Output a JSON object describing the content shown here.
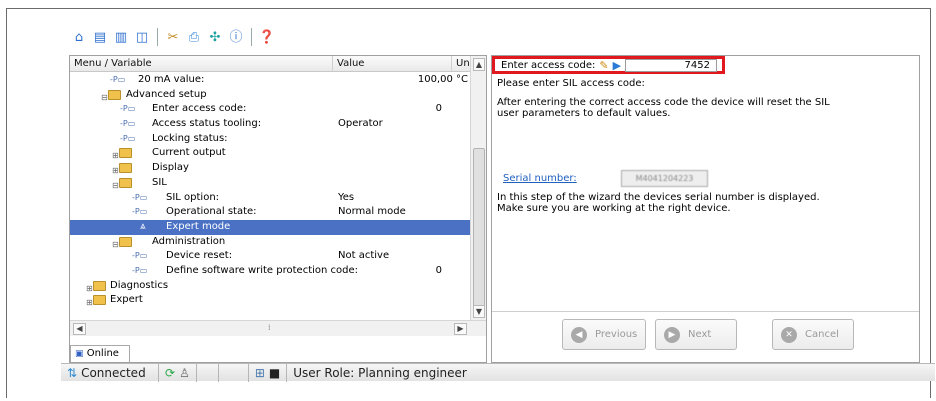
{
  "toolbar": {
    "icons": [
      "home-icon",
      "layout-split-icon",
      "layout-full-icon",
      "window-icon",
      "tools-icon",
      "print-icon",
      "network-icon",
      "info-icon",
      "help-icon"
    ]
  },
  "grid": {
    "col_menu": "Menu / Variable",
    "col_value": "Value",
    "col_unit": "Unit"
  },
  "tree": {
    "ma20_label": "20 mA value:",
    "ma20_value": "100,00 °C",
    "advanced_setup": "Advanced setup",
    "enter_access_code_label": "Enter access code:",
    "enter_access_code_value": "0",
    "access_status_label": "Access status tooling:",
    "access_status_value": "Operator",
    "locking_status_label": "Locking status:",
    "current_output": "Current output",
    "display": "Display",
    "sil": "SIL",
    "sil_option_label": "SIL option:",
    "sil_option_value": "Yes",
    "operational_state_label": "Operational state:",
    "operational_state_value": "Normal mode",
    "expert_mode": "Expert mode",
    "administration": "Administration",
    "device_reset_label": "Device reset:",
    "device_reset_value": "Not active",
    "write_protection_label": "Define software write protection code:",
    "write_protection_value": "0",
    "diagnostics": "Diagnostics",
    "expert": "Expert"
  },
  "tabs": {
    "online": "Online"
  },
  "status": {
    "connected": "Connected",
    "user_role": "User Role: Planning engineer"
  },
  "wizard": {
    "access_label": "Enter access code:",
    "access_value": "7452",
    "prompt": "Please enter SIL access code:",
    "reset_note_1": "After entering the correct access code the device will reset the SIL",
    "reset_note_2": "user parameters to default values.",
    "serial_label": "Serial number:",
    "serial_value": "M4041204223",
    "serial_note_1": "In this step of the wizard the devices serial number is displayed.",
    "serial_note_2": "Make sure you are working at the right device.",
    "previous": "Previous",
    "next": "Next",
    "cancel": "Cancel"
  },
  "colors": {
    "highlight_row": "#4a71c4",
    "callout_red": "#e2181f",
    "link_blue": "#2060c0"
  }
}
